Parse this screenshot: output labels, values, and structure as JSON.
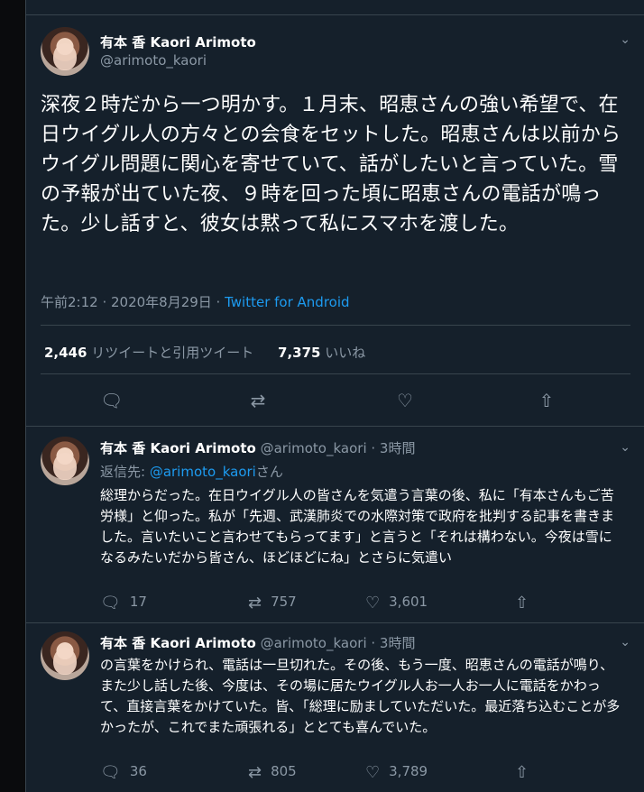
{
  "main": {
    "display_name": "有本 香 Kaori Arimoto",
    "handle": "@arimoto_kaori",
    "text": "深夜２時だから一つ明かす。１月末、昭恵さんの強い希望で、在日ウイグル人の方々との会食をセットした。昭恵さんは以前からウイグル問題に関心を寄せていて、話がしたいと言っていた。雪の予報が出ていた夜、９時を回った頃に昭恵さんの電話が鳴った。少し話すと、彼女は黙って私にスマホを渡した。",
    "timestamp": "午前2:12 · 2020年8月29日 · ",
    "source": "Twitter for Android",
    "retweets_count": "2,446",
    "retweets_label": "リツイートと引用ツイート",
    "likes_count": "7,375",
    "likes_label": "いいね"
  },
  "replies": [
    {
      "display_name": "有本 香 Kaori Arimoto",
      "handle_time": "@arimoto_kaori · 3時間",
      "reply_prefix": "返信先: ",
      "reply_mention": "@arimoto_kaori",
      "reply_suffix": "さん",
      "text": "総理からだった。在日ウイグル人の皆さんを気遣う言葉の後、私に「有本さんもご苦労様」と仰った。私が「先週、武漢肺炎での水際対策で政府を批判する記事を書きました。言いたいこと言わせてもらってます」と言うと「それは構わない。今夜は雪になるみたいだから皆さん、ほどほどにね」とさらに気遣い",
      "replies": "17",
      "retweets": "757",
      "likes": "3,601"
    },
    {
      "display_name": "有本 香 Kaori Arimoto",
      "handle_time": "@arimoto_kaori · 3時間",
      "text": "の言葉をかけられ、電話は一旦切れた。その後、もう一度、昭恵さんの電話が鳴り、また少し話した後、今度は、その場に居たウイグル人お一人お一人に電話をかわって、直接言葉をかけていた。皆、「総理に励ましていただいた。最近落ち込むことが多かったが、これでまた頑張れる」ととても喜んでいた。",
      "replies": "36",
      "retweets": "805",
      "likes": "3,789"
    }
  ],
  "icons": {
    "reply": "reply-icon",
    "retweet": "retweet-icon",
    "like": "heart-icon",
    "share": "share-icon",
    "more": "chevron-down-icon"
  },
  "colors": {
    "background": "#15202b",
    "accent": "#1d9bf0",
    "muted": "#8b98a5"
  }
}
